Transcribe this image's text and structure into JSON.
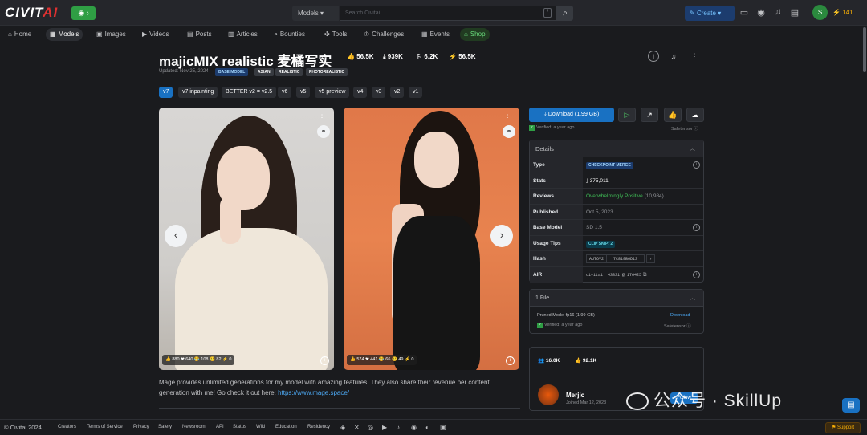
{
  "header": {
    "logo_left": "CIVIT",
    "logo_right": "AI",
    "logo_badge": "◉ ›",
    "search_select": "Models",
    "search_placeholder": "Search Civitai",
    "search_slash": "/",
    "create_label": "Create",
    "avatar_letter": "S",
    "buzz_count": "141"
  },
  "nav": {
    "items": [
      {
        "label": "Home",
        "icon": "⌂"
      },
      {
        "label": "Models",
        "icon": "▦"
      },
      {
        "label": "Images",
        "icon": "▣"
      },
      {
        "label": "Videos",
        "icon": "▶"
      },
      {
        "label": "Posts",
        "icon": "▤"
      },
      {
        "label": "Articles",
        "icon": "▥"
      },
      {
        "label": "Bounties",
        "icon": "◔"
      },
      {
        "label": "Tools",
        "icon": "✣"
      },
      {
        "label": "Challenges",
        "icon": "♔"
      },
      {
        "label": "Events",
        "icon": "▦"
      },
      {
        "label": "Shop",
        "icon": "⌂"
      }
    ]
  },
  "model": {
    "title": "majicMIX realistic 麦橘写实",
    "stats": {
      "likes": "56.5K",
      "downloads": "939K",
      "collected": "6.2K",
      "buzz": "56.5K"
    },
    "updated": "Updated: Nov 25, 2024",
    "tags": [
      "BASE MODEL",
      "ASIAN",
      "REALISTIC",
      "PHOTOREALISTIC"
    ],
    "versions": [
      "v7",
      "v7 inpainting",
      "BETTER v2 = v2.5",
      "v6",
      "v5",
      "v5 preview",
      "v4",
      "v3",
      "v2",
      "v1"
    ],
    "description": "Mage provides unlimited generations for my model with amazing features. They also share their revenue per content generation with me! Go check it out here: ",
    "description_link": "https://www.mage.space/"
  },
  "images": [
    {
      "reactions": "👍 880  ❤ 640  😂 108  😢 82  ⚡ 0"
    },
    {
      "reactions": "👍 574  ❤ 441  😂 66  😢 49  ⚡ 0"
    }
  ],
  "sidebar": {
    "download_label": "Download (1.99 GB)",
    "verified": "Verified: a year ago",
    "safetensor": "Safetensor",
    "details_title": "Details",
    "details": {
      "type_label": "Type",
      "type_value": "CHECKPOINT MERGE",
      "stats_label": "Stats",
      "stats_value": "375,011",
      "reviews_label": "Reviews",
      "reviews_value": "Overwhelmingly Positive",
      "reviews_count": "(10,984)",
      "published_label": "Published",
      "published_value": "Oct 5, 2023",
      "base_label": "Base Model",
      "base_value": "SD 1.5",
      "usage_label": "Usage Tips",
      "usage_value": "CLIP SKIP: 2",
      "hash_label": "Hash",
      "hash_algo": "AUTOV2",
      "hash_value": "7C819B6D13",
      "air_label": "AIR",
      "air_value": "civitai: 43331 @ 176425"
    },
    "files_title": "1 File",
    "file_name": "Pruned Model fp16 (1.99 GB)",
    "file_download": "Download",
    "file_verified": "Verified: a year ago",
    "file_safe": "Safetensor",
    "creator": {
      "followers": "16.0K",
      "likes": "92.1K",
      "name": "Merjic",
      "joined": "Joined Mar 12, 2023",
      "follow": "Follow"
    }
  },
  "watermark": "公众号 · SkillUp",
  "footer": {
    "copyright": "© Civitai 2024",
    "links": [
      "Creators",
      "Terms of Service",
      "Privacy",
      "Safety",
      "Newsroom",
      "API",
      "Status",
      "Wiki",
      "Education",
      "Residency"
    ],
    "support": "Support"
  }
}
